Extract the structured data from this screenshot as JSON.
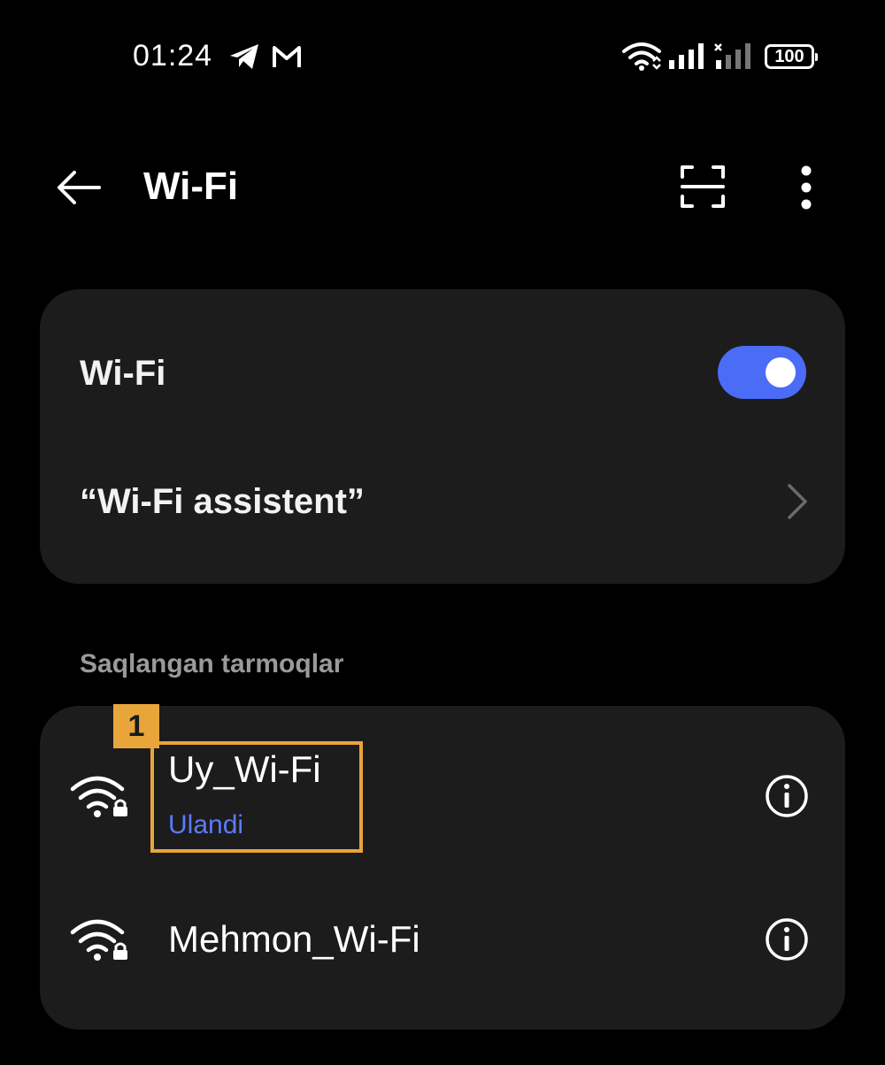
{
  "status_bar": {
    "time": "01:24",
    "battery": "100",
    "icons": [
      "telegram-icon",
      "gmail-icon",
      "wifi-status-icon",
      "signal-icon",
      "signal-no-service-icon",
      "battery-icon"
    ]
  },
  "header": {
    "title": "Wi-Fi",
    "back_icon": "arrow-left-icon",
    "scan_icon": "qr-scan-icon",
    "menu_icon": "more-vertical-icon"
  },
  "wifi_card": {
    "toggle_label": "Wi-Fi",
    "toggle_on": true,
    "assistant_label": "“Wi-Fi assistent”"
  },
  "saved_networks": {
    "section_label": "Saqlangan tarmoqlar",
    "items": [
      {
        "name": "Uy_Wi-Fi",
        "status": "Ulandi",
        "icon": "wifi-lock-icon"
      },
      {
        "name": "Mehmon_Wi-Fi",
        "status": "",
        "icon": "wifi-lock-icon"
      }
    ]
  },
  "annotation": {
    "marker": "1"
  },
  "colors": {
    "accent": "#4a6cf7",
    "status": "#5b7bff",
    "highlight": "#e8a53a",
    "card": "#1c1c1c"
  }
}
